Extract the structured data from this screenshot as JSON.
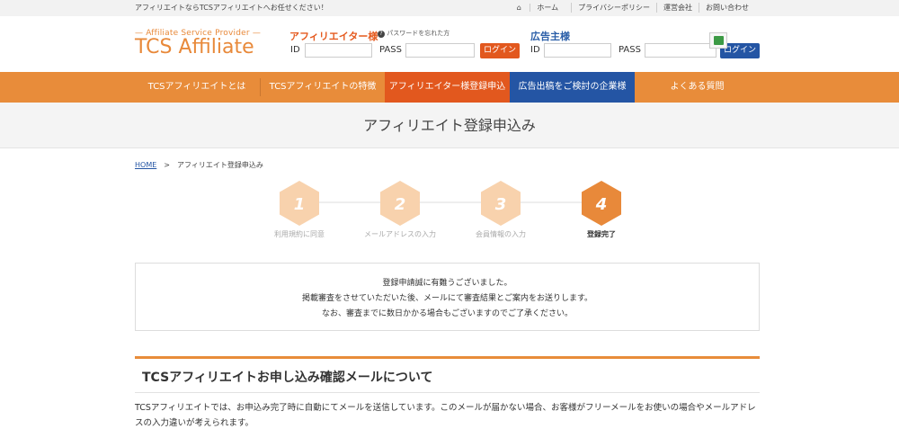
{
  "topbar": {
    "tagline": "アフィリエイトならTCSアフィリエイトへお任せください！",
    "links": [
      "ホーム",
      "プライバシーポリシー",
      "運営会社",
      "お問い合わせ"
    ]
  },
  "logo": {
    "small": "— Affiliate Service Provider —",
    "big": "TCS Affiliate"
  },
  "affiliate_login": {
    "heading": "アフィリエイター様",
    "forgot": "パスワードを忘れた方",
    "id_label": "ID",
    "pass_label": "PASS",
    "button": "ログイン"
  },
  "advertiser_login": {
    "heading": "広告主様",
    "id_label": "ID",
    "pass_label": "PASS",
    "button": "ログイン"
  },
  "nav": {
    "items": [
      "TCSアフィリエイトとは",
      "TCSアフィリエイトの特徴",
      "アフィリエイター様登録申込",
      "広告出稿をご検討の企業様",
      "よくある質問"
    ]
  },
  "page": {
    "title": "アフィリエイト登録申込み"
  },
  "breadcrumb": {
    "home": "HOME",
    "separator": ">",
    "current": "アフィリエイト登録申込み"
  },
  "steps": [
    {
      "number": "1",
      "label": "利用規約に同意"
    },
    {
      "number": "2",
      "label": "メールアドレスの入力"
    },
    {
      "number": "3",
      "label": "会員情報の入力"
    },
    {
      "number": "4",
      "label": "登録完了"
    }
  ],
  "current_step": 4,
  "message": {
    "line1": "登録申請誠に有難うございました。",
    "line2": "掲載審査をさせていただいた後、メールにて審査結果とご案内をお送りします。",
    "line3": "なお、審査までに数日かかる場合もございますのでご了承ください。"
  },
  "section": {
    "title": "TCSアフィリエイトお申し込み確認メールについて",
    "body": "TCSアフィリエイトでは、お申込み完了時に自動にてメールを送信しています。このメールが届かない場合、お客様がフリーメールをお使いの場合やメールアドレスの入力違いが考えられます。"
  },
  "colors": {
    "accent_orange": "#e88c3a",
    "accent_red": "#e2581e",
    "accent_blue": "#2455a4",
    "step_inactive": "#f8d2ad",
    "step_active": "#e8893a"
  }
}
